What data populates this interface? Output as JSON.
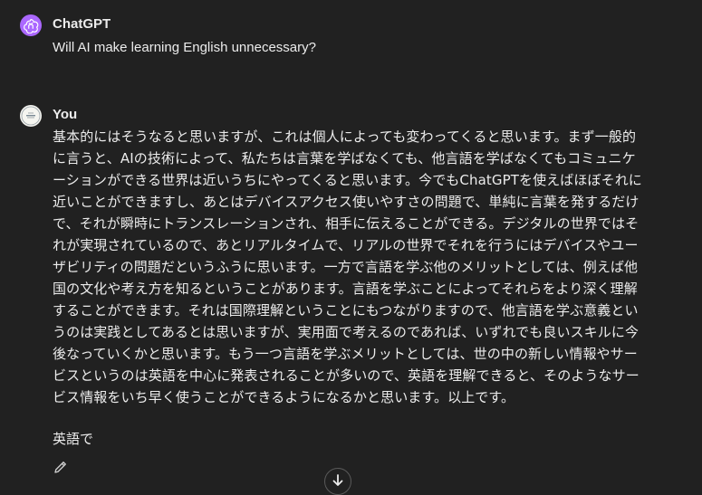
{
  "messages": [
    {
      "author": "ChatGPT",
      "avatar_icon": "openai-logo-icon",
      "avatar_color": "#ab68ff",
      "text": "Will AI make learning English unnecessary?"
    },
    {
      "author": "You",
      "avatar_icon": "user-avatar-icon",
      "avatar_color": "#f2f2ee",
      "text": "基本的にはそうなると思いますが、これは個人によっても変わってくると思います。まず一般的\nに言うと、AIの技術によって、私たちは言葉を学ばなくても、他言語を学ばなくてもコミュニケ\nーションができる世界は近いうちにやってくると思います。今でもChatGPTを使えばほぼそれに\n近いことができますし、あとはデバイスアクセス使いやすさの問題で、単純に言葉を発するだけ\nで、それが瞬時にトランスレーションされ、相手に伝えることができる。デジタルの世界ではそ\nれが実現されているので、あとリアルタイムで、リアルの世界でそれを行うにはデバイスやユー\nザビリティの問題だというふうに思います。一方で言語を学ぶ他のメリットとしては、例えば他\n国の文化や考え方を知るということがあります。言語を学ぶことによってそれらをより深く理解\nすることができます。それは国際理解ということにもつながりますので、他言語を学ぶ意義とい\nうのは実践としてあるとは思いますが、実用面で考えるのであれば、いずれでも良いスキルに今\n後なっていくかと思います。もう一つ言語を学ぶメリットとしては、世の中の新しい情報やサー\nビスというのは英語を中心に発表されることが多いので、英語を理解できると、そのようなサー\nビス情報をいち早く使うことができるようになるかと思います。以上です。"
    }
  ],
  "draft_text": "英語で",
  "actions": {
    "edit_icon": "pencil-icon",
    "scroll_icon": "arrow-down-icon"
  }
}
